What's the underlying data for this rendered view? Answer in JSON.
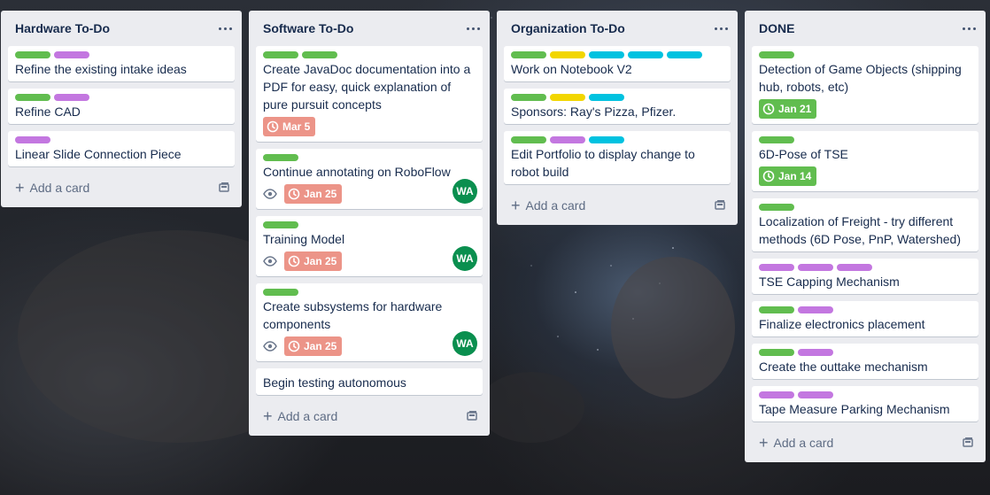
{
  "colors": {
    "list_bg": "#ebecf0",
    "label_green": "#61bd4f",
    "label_purple": "#c377e0",
    "label_yellow": "#f2d600",
    "label_sky": "#00c2e0",
    "due_overdue": "#ec9488",
    "due_complete": "#61bd4f",
    "avatar": "#0a8f4f"
  },
  "add_card_label": "Add a card",
  "lists": [
    {
      "title": "Hardware To-Do",
      "cards": [
        {
          "labels": [
            "green",
            "purple"
          ],
          "title": "Refine the existing intake ideas"
        },
        {
          "labels": [
            "green",
            "purple"
          ],
          "title": "Refine CAD"
        },
        {
          "labels": [
            "purple"
          ],
          "title": "Linear Slide Connection Piece"
        }
      ]
    },
    {
      "title": "Software To-Do",
      "cards": [
        {
          "labels": [
            "green",
            "green"
          ],
          "title": "Create JavaDoc documentation into a PDF for easy, quick explanation of pure pursuit concepts",
          "due": "Mar 5"
        },
        {
          "labels": [
            "green"
          ],
          "title": "Continue annotating on RoboFlow",
          "watch": true,
          "due": "Jan 25",
          "avatar": "WA"
        },
        {
          "labels": [
            "green"
          ],
          "title": "Training Model",
          "watch": true,
          "due": "Jan 25",
          "avatar": "WA"
        },
        {
          "labels": [
            "green"
          ],
          "title": "Create subsystems for hardware components",
          "watch": true,
          "due": "Jan 25",
          "avatar": "WA"
        },
        {
          "labels": [],
          "title": "Begin testing autonomous"
        }
      ]
    },
    {
      "title": "Organization To-Do",
      "cards": [
        {
          "labels": [
            "green",
            "yellow",
            "sky",
            "sky",
            "sky"
          ],
          "title": "Work on Notebook V2"
        },
        {
          "labels": [
            "green",
            "yellow",
            "sky"
          ],
          "title": "Sponsors: Ray's Pizza, Pfizer."
        },
        {
          "labels": [
            "green",
            "purple",
            "sky"
          ],
          "title": "Edit Portfolio to display change to robot build"
        }
      ]
    },
    {
      "title": "DONE",
      "cards": [
        {
          "labels": [
            "green"
          ],
          "title": "Detection of Game Objects (shipping hub, robots, etc)",
          "done_due": "Jan 21"
        },
        {
          "labels": [
            "green"
          ],
          "title": "6D-Pose of TSE",
          "done_due": "Jan 14"
        },
        {
          "labels": [
            "green"
          ],
          "title": "Localization of Freight - try different methods (6D Pose, PnP, Watershed)"
        },
        {
          "labels": [
            "purple",
            "purple",
            "purple"
          ],
          "title": "TSE Capping Mechanism"
        },
        {
          "labels": [
            "green",
            "purple"
          ],
          "title": "Finalize electronics placement"
        },
        {
          "labels": [
            "green",
            "purple"
          ],
          "title": "Create the outtake mechanism"
        },
        {
          "labels": [
            "purple",
            "purple"
          ],
          "title": "Tape Measure Parking Mechanism"
        }
      ]
    }
  ]
}
